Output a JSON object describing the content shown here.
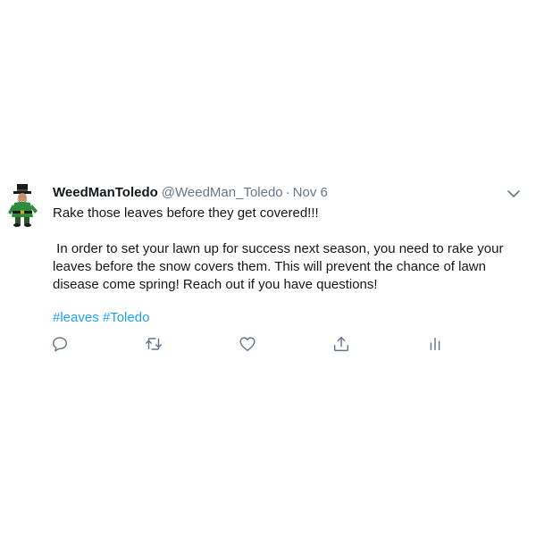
{
  "tweet": {
    "display_name": "WeedManToledo",
    "handle": "@WeedMan_Toledo",
    "separator": "·",
    "date": "Nov 6",
    "text_lines": [
      "Rake those leaves before they get covered!!!",
      " In order to set your lawn up for success next season, you need to rake your",
      "leaves before the snow covers them. This will prevent the chance of lawn",
      "disease come spring! Reach out if you have questions!"
    ],
    "hashtags": [
      "#leaves",
      "#Toledo"
    ]
  },
  "icons": {
    "more": "chevron-down-icon",
    "reply": "reply-icon",
    "retweet": "retweet-icon",
    "like": "heart-icon",
    "share": "share-icon",
    "analytics": "analytics-icon"
  },
  "colors": {
    "text": "#14171a",
    "secondary": "#657786",
    "link": "#1da1f2",
    "avatar_green": "#2e8b3e",
    "avatar_dark": "#1a1a1a"
  }
}
